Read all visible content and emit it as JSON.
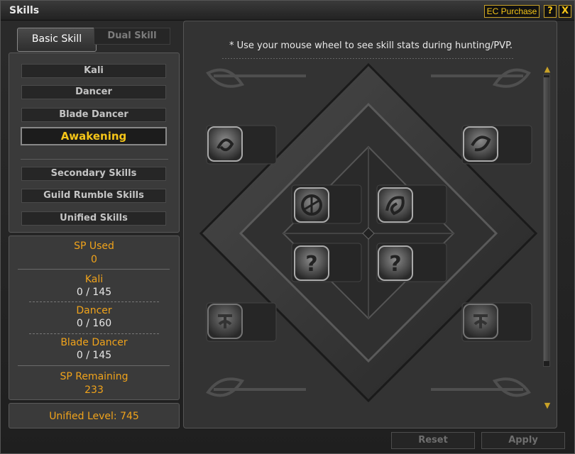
{
  "window": {
    "title": "Skills",
    "ec_purchase": "EC Purchase",
    "help_label": "?",
    "close_label": "X"
  },
  "tabs": [
    {
      "label": "Basic Skill",
      "active": true
    },
    {
      "label": "Dual Skill",
      "active": false
    }
  ],
  "nav": {
    "items": [
      {
        "label": "Kali"
      },
      {
        "label": "Dancer"
      },
      {
        "label": "Blade Dancer"
      },
      {
        "label": "Awakening",
        "active": true
      }
    ],
    "secondary": [
      {
        "label": "Secondary Skills"
      },
      {
        "label": "Guild Rumble Skills"
      },
      {
        "label": "Unified Skills"
      }
    ]
  },
  "stats": {
    "sp_used_label": "SP Used",
    "sp_used_value": "0",
    "kali_label": "Kali",
    "kali_value": "0 / 145",
    "dancer_label": "Dancer",
    "dancer_value": "0 / 160",
    "blade_dancer_label": "Blade Dancer",
    "blade_dancer_value": "0 / 145",
    "sp_remaining_label": "SP Remaining",
    "sp_remaining_value": "233"
  },
  "unified_level": "Unified Level: 745",
  "hint": "* Use your mouse wheel to see skill stats during hunting/PVP.",
  "skill_slots": {
    "unlocked_icon": "swirl-skill-icon",
    "locked_icon": "question-mark-icon",
    "sealed_icon": "sealed-skill-icon",
    "locked_mark": "?"
  },
  "buttons": {
    "reset": "Reset",
    "apply": "Apply"
  },
  "colors": {
    "accent_gold": "#f0a31b",
    "active_yellow": "#f5c518",
    "panel": "#3a3a3a",
    "disabled_text": "#6e6e6e"
  }
}
